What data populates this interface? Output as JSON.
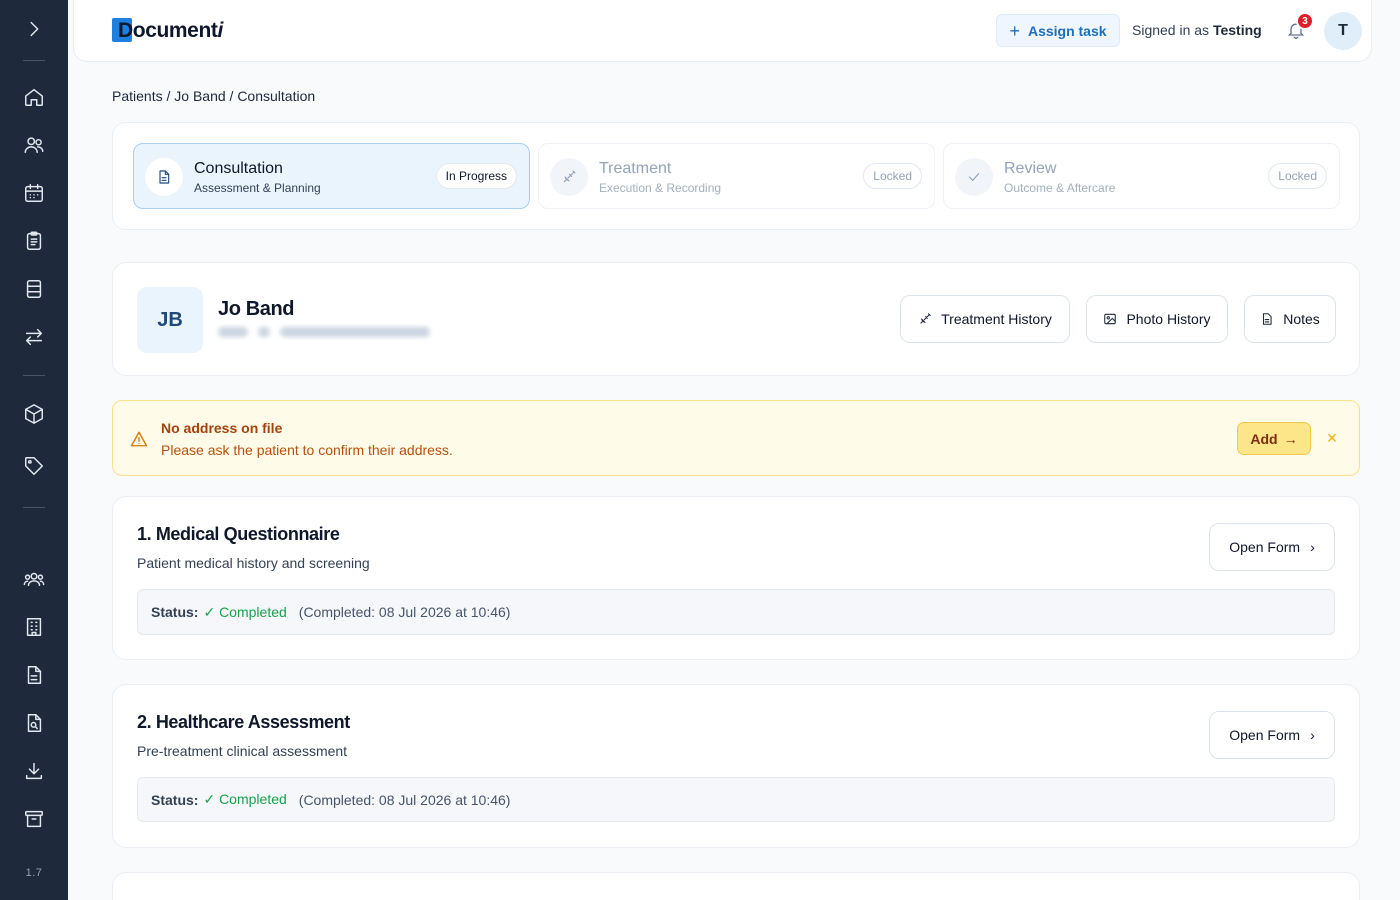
{
  "app": {
    "logo_text": "Document",
    "logo_italic": "i",
    "version": "1.7"
  },
  "sidebar": {
    "items": [
      {
        "name": "expand",
        "icon": "chevron-right-icon"
      },
      {
        "name": "home",
        "icon": "home-icon"
      },
      {
        "name": "patients",
        "icon": "users-icon"
      },
      {
        "name": "calendar",
        "icon": "calendar-icon"
      },
      {
        "name": "clipboard",
        "icon": "clipboard-icon"
      },
      {
        "name": "forms",
        "icon": "layout-icon"
      },
      {
        "name": "transfers",
        "icon": "arrows-swap-icon"
      },
      {
        "name": "products",
        "icon": "box-icon"
      },
      {
        "name": "tags",
        "icon": "tag-icon"
      },
      {
        "name": "team",
        "icon": "group-icon"
      },
      {
        "name": "clinic",
        "icon": "building-icon"
      },
      {
        "name": "documents",
        "icon": "file-icon"
      },
      {
        "name": "search-docs",
        "icon": "file-search-icon"
      },
      {
        "name": "downloads",
        "icon": "download-icon"
      },
      {
        "name": "archive",
        "icon": "archive-icon"
      }
    ]
  },
  "header": {
    "assign_task": "Assign task",
    "signed_in_prefix": "Signed in as",
    "user_name": "Testing",
    "notifications_count": "3",
    "avatar_initial": "T"
  },
  "breadcrumb": {
    "items": [
      "Patients",
      "Jo Band",
      "Consultation"
    ],
    "separator": "/"
  },
  "steps": [
    {
      "title": "Consultation",
      "subtitle": "Assessment & Planning",
      "badge": "In Progress",
      "state": "active",
      "icon": "document-icon"
    },
    {
      "title": "Treatment",
      "subtitle": "Execution & Recording",
      "badge": "Locked",
      "state": "locked",
      "icon": "syringe-icon"
    },
    {
      "title": "Review",
      "subtitle": "Outcome & Aftercare",
      "badge": "Locked",
      "state": "locked",
      "icon": "check-icon"
    }
  ],
  "patient": {
    "initials": "JB",
    "name": "Jo Band",
    "buttons": {
      "treatment_history": "Treatment History",
      "photo_history": "Photo History",
      "notes": "Notes"
    }
  },
  "alert": {
    "title": "No address on file",
    "message": "Please ask the patient to confirm their address.",
    "action": "Add",
    "close": "×"
  },
  "forms": [
    {
      "title": "1. Medical Questionnaire",
      "subtitle": "Patient medical history and screening",
      "button": "Open Form",
      "status_label": "Status:",
      "status_value": "✓ Completed",
      "status_date": "(Completed: 08 Jul 2026 at 10:46)"
    },
    {
      "title": "2. Healthcare Assessment",
      "subtitle": "Pre-treatment clinical assessment",
      "button": "Open Form",
      "status_label": "Status:",
      "status_value": "✓ Completed",
      "status_date": "(Completed: 08 Jul 2026 at 10:46)"
    }
  ],
  "colors": {
    "sidebar_bg": "#1e293b",
    "accent": "#1d7fe0",
    "success": "#16a34a",
    "warning": "#d97706"
  }
}
